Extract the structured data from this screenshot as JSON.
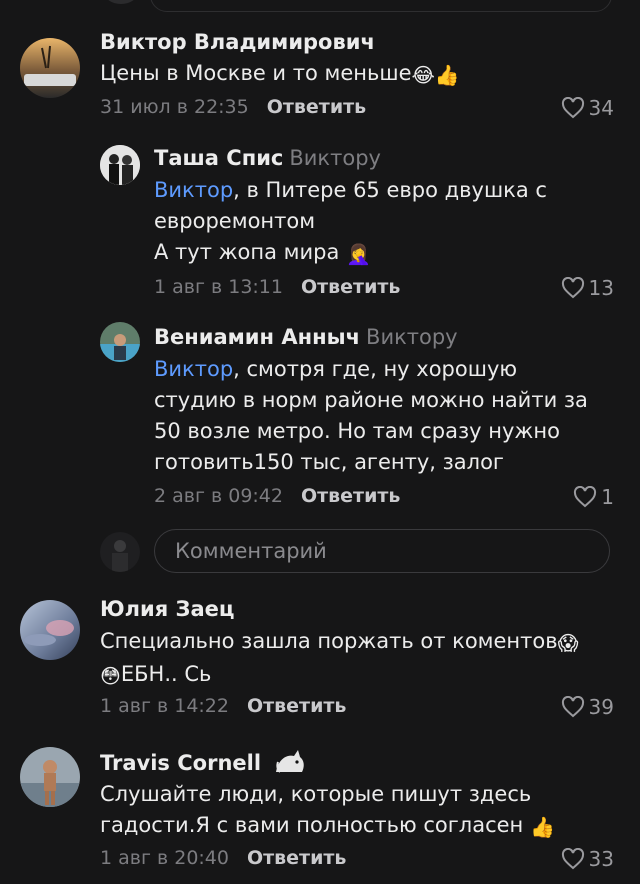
{
  "composer": {
    "placeholder": "Комментарий"
  },
  "reply_label": "Ответить",
  "comments": [
    {
      "name": "Виктор Владимирович",
      "text": "Цены в Москве и то меньше",
      "emojis": "😂👍",
      "time": "31 июл в 22:35",
      "likes": "34"
    },
    {
      "name": "Таша Спис",
      "reply_to": "Виктору",
      "mention": "Виктор",
      "line1_rest": ", в Питере 65 евро двушка с",
      "line2": "евроремонтом",
      "line3": "А тут жопа мира",
      "emoji": "🤦‍♀️",
      "time": "1 авг в 13:11",
      "likes": "13"
    },
    {
      "name": "Вениамин Анныч",
      "reply_to": "Виктору",
      "mention": "Виктор",
      "line1_rest": ", смотря где, ну хорошую",
      "line2": "студию в норм районе можно найти за",
      "line3": "50 возле метро. Но там сразу нужно",
      "line4": "готовить150 тыс, агенту, залог",
      "time": "2 авг в 09:42",
      "likes": "1"
    },
    {
      "name": "Юлия Заец",
      "line1": "Специально зашла поржать от коментов",
      "emoji1": "😱",
      "emoji2": "😳",
      "line2": "ЕБН.. Сь",
      "time": "1 авг в 14:22",
      "likes": "39"
    },
    {
      "name": "Travis Cornell",
      "line1": "Слушайте люди, которые пишут здесь",
      "line2": "гадости.Я с вами полностью согласен",
      "emoji": "👍",
      "time": "1 авг в 20:40",
      "likes": "33"
    }
  ]
}
